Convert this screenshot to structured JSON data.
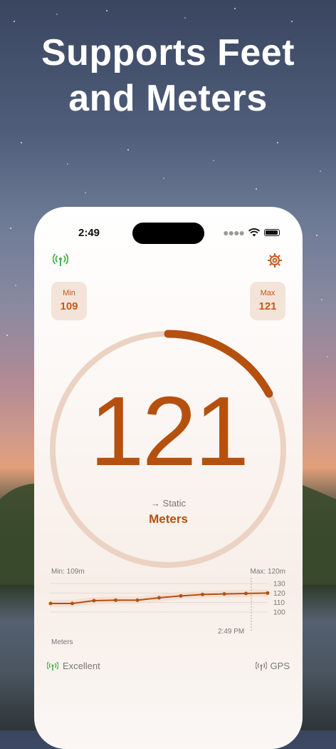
{
  "headline": {
    "line1": "Supports Feet",
    "line2": "and Meters"
  },
  "status_bar": {
    "time": "2:49"
  },
  "app": {
    "min": {
      "label": "Min",
      "value": "109"
    },
    "max": {
      "label": "Max",
      "value": "121"
    },
    "current_value": "121",
    "trend_label": "→ Static",
    "unit": "Meters",
    "gauge_fraction": 0.17,
    "accent_color": "#c55a1a",
    "signal_color": "#3bb54a"
  },
  "chart_data": {
    "type": "line",
    "min_label": "Min: 109m",
    "max_label": "Max: 120m",
    "unit_label": "Meters",
    "time_label": "2:49 PM",
    "y_ticks": [
      "130",
      "120",
      "110",
      "100"
    ],
    "ylim": [
      100,
      130
    ],
    "values": [
      109,
      109,
      112,
      112.5,
      112.5,
      115,
      117,
      118.5,
      119,
      119.5,
      120
    ]
  },
  "footer": {
    "signal_quality": "Excellent",
    "source": "GPS"
  }
}
